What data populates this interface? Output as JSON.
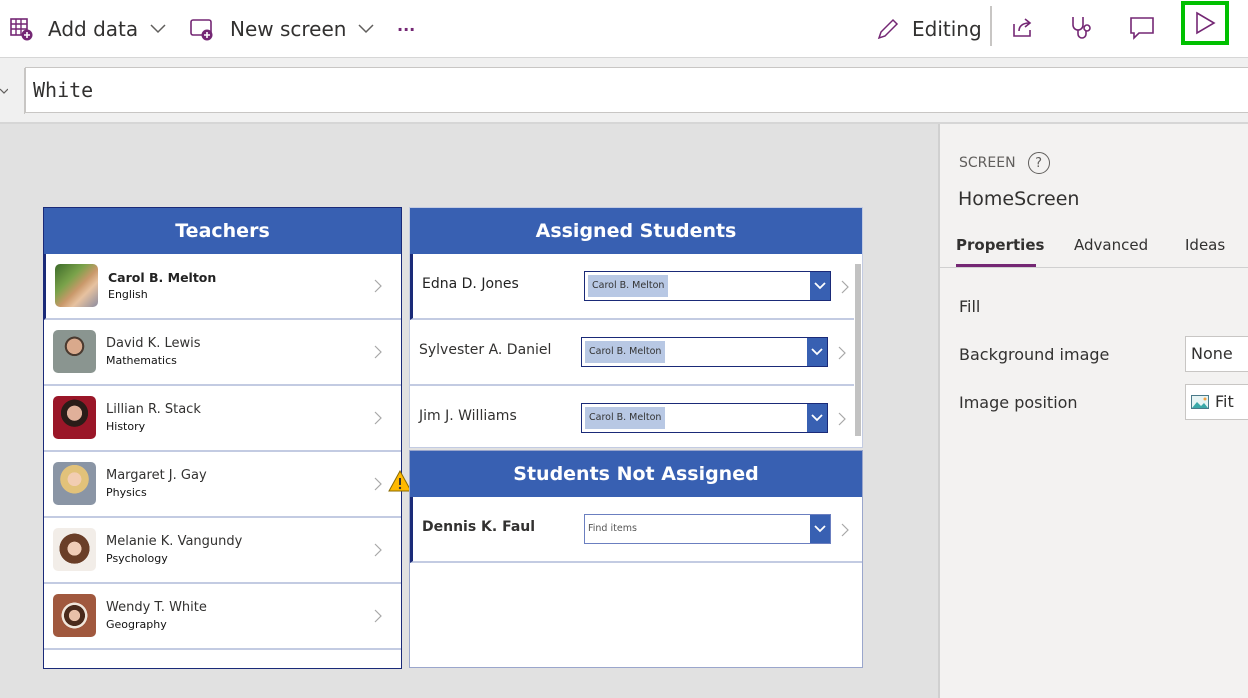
{
  "toolbar": {
    "add_data": "Add data",
    "new_screen": "New screen",
    "more": "···",
    "editing": "Editing"
  },
  "formula_bar": {
    "value": "White"
  },
  "teachers": {
    "title": "Teachers",
    "items": [
      {
        "name": "Carol B. Melton",
        "subject": "English",
        "selected": true
      },
      {
        "name": "David K. Lewis",
        "subject": "Mathematics"
      },
      {
        "name": "Lillian R. Stack",
        "subject": "History"
      },
      {
        "name": "Margaret J. Gay",
        "subject": "Physics"
      },
      {
        "name": "Melanie K. Vangundy",
        "subject": "Psychology"
      },
      {
        "name": "Wendy T. White",
        "subject": "Geography"
      }
    ]
  },
  "assigned_students": {
    "title": "Assigned Students",
    "items": [
      {
        "name": "Edna D. Jones",
        "teacher": "Carol B. Melton",
        "selected": true
      },
      {
        "name": "Sylvester A. Daniel",
        "teacher": "Carol B. Melton"
      },
      {
        "name": "Jim J. Williams",
        "teacher": "Carol B. Melton"
      }
    ]
  },
  "students_not_assigned": {
    "title": "Students Not Assigned",
    "items": [
      {
        "name": "Dennis K. Faul",
        "placeholder": "Find items",
        "selected": true
      }
    ]
  },
  "right_panel": {
    "type_label": "SCREEN",
    "help": "?",
    "screen_name": "HomeScreen",
    "tabs": [
      "Properties",
      "Advanced",
      "Ideas"
    ],
    "active_tab": "Properties",
    "properties": {
      "fill_label": "Fill",
      "background_image_label": "Background image",
      "background_image_value": "None",
      "image_position_label": "Image position",
      "image_position_value": "Fit"
    }
  },
  "colors": {
    "brand_purple": "#742774",
    "header_blue": "#3860b2",
    "highlight_green": "#00c000",
    "warning_yellow": "#ffb900"
  }
}
